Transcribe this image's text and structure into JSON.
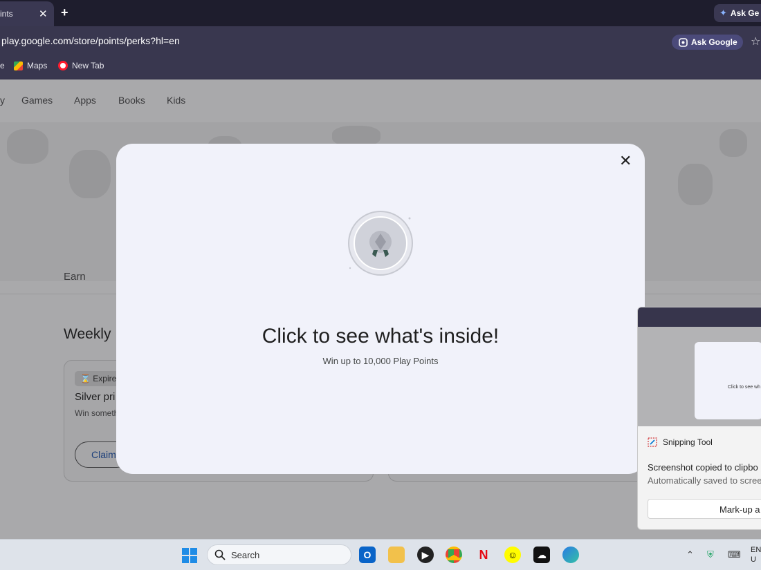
{
  "browser": {
    "tab_title": "ints",
    "close_glyph": "✕",
    "new_tab_glyph": "+",
    "ask_gemini": "Ask Ge",
    "url": "play.google.com/store/points/perks?hl=en",
    "ask_google": "Ask Google",
    "bookmark_cut": "e",
    "bookmarks": [
      {
        "label": "Maps",
        "icon": "maps-icon"
      },
      {
        "label": "New Tab",
        "icon": "opera-icon"
      }
    ]
  },
  "play_nav": {
    "cut_item": "y",
    "items": [
      "Games",
      "Apps",
      "Books",
      "Kids"
    ]
  },
  "page": {
    "earn_tab": "Earn",
    "weekly_heading": "Weekly",
    "card": {
      "expires": "Expires",
      "title": "Silver pri",
      "subtitle": "Win someth",
      "claim_label": "Claim"
    }
  },
  "modal": {
    "close_glyph": "✕",
    "title": "Click to see what's inside!",
    "subtitle": "Win up to 10,000 Play Points"
  },
  "snipping_toast": {
    "app_name": "Snipping Tool",
    "message": "Screenshot copied to clipbo",
    "sub_message": "Automatically saved to scree",
    "button_label": "Mark-up a",
    "thumb_text": "Click to see wh"
  },
  "taskbar": {
    "search_label": "Search",
    "lang_top": "EN",
    "lang_bottom": "U"
  },
  "colors": {
    "accent": "#1c3f7a",
    "modal_bg": "#f1f2fa",
    "overlay": "#a9a9ab"
  }
}
